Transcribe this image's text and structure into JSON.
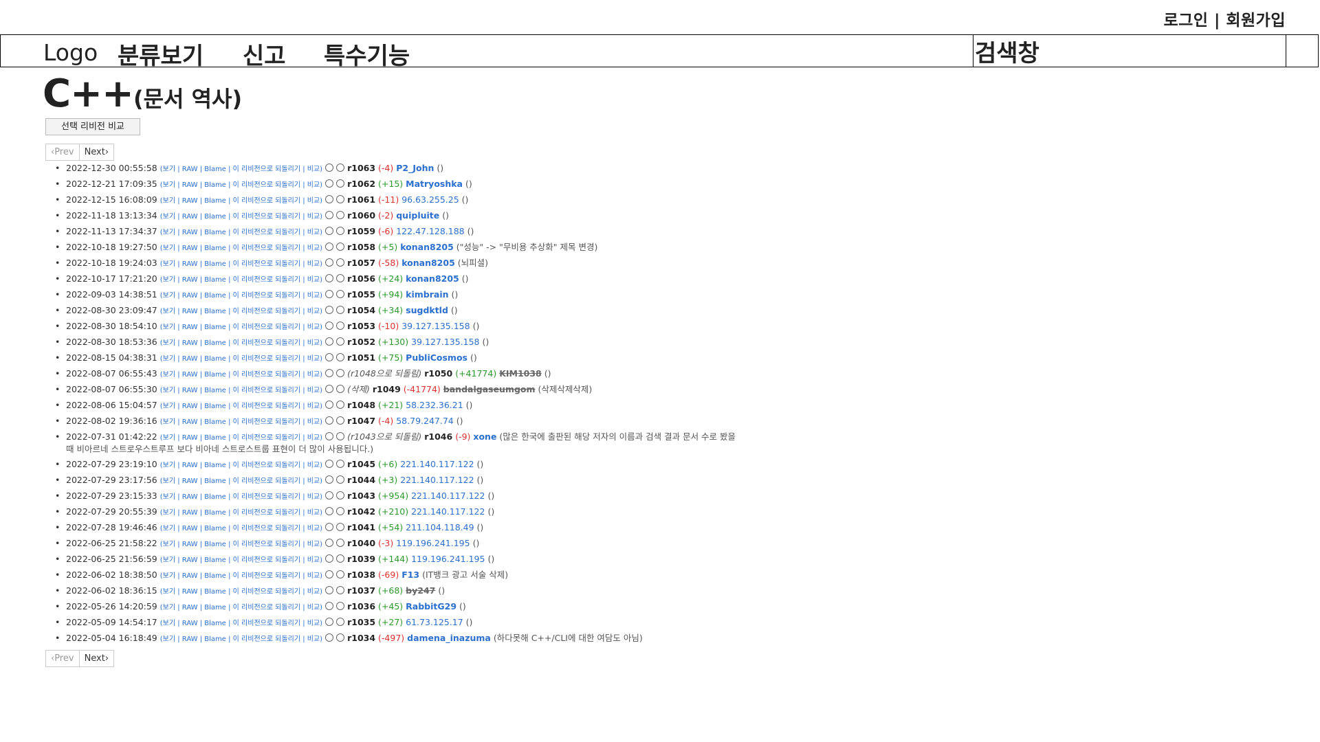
{
  "auth": {
    "login": "로그인",
    "sep": " | ",
    "signup": "회원가입"
  },
  "nav": {
    "logo": "Logo",
    "category": "분류보기",
    "report": "신고",
    "special": "특수기능",
    "search": "검색창"
  },
  "title": {
    "main": "C++",
    "sub": "(문서 역사)"
  },
  "compare_button": "선택 리비전 비교",
  "pager": {
    "prev": "‹Prev",
    "next": "Next›"
  },
  "link_labels": {
    "open": "(",
    "view": "보기",
    "raw": "RAW",
    "blame": "Blame",
    "revert": "이 리비전으로 되돌리기",
    "compare": "비교",
    "close": ")"
  },
  "revisions": [
    {
      "date": "2022-12-30 00:55:58",
      "rev": "r1063",
      "change": "(-4)",
      "sign": "neg",
      "author": "P2_John",
      "author_type": "user",
      "note": "()"
    },
    {
      "date": "2022-12-21 17:09:35",
      "rev": "r1062",
      "change": "(+15)",
      "sign": "pos",
      "author": "Matryoshka",
      "author_type": "user",
      "note": "()"
    },
    {
      "date": "2022-12-15 16:08:09",
      "rev": "r1061",
      "change": "(-11)",
      "sign": "neg",
      "author": "96.63.255.25",
      "author_type": "ip",
      "note": "()"
    },
    {
      "date": "2022-11-18 13:13:34",
      "rev": "r1060",
      "change": "(-2)",
      "sign": "neg",
      "author": "quipluite",
      "author_type": "user",
      "note": "()"
    },
    {
      "date": "2022-11-13 17:34:37",
      "rev": "r1059",
      "change": "(-6)",
      "sign": "neg",
      "author": "122.47.128.188",
      "author_type": "ip",
      "note": "()"
    },
    {
      "date": "2022-10-18 19:27:50",
      "rev": "r1058",
      "change": "(+5)",
      "sign": "pos",
      "author": "konan8205",
      "author_type": "user",
      "note": "(\"성능\" -> \"무비용 추상화\" 제목 변경)"
    },
    {
      "date": "2022-10-18 19:24:03",
      "rev": "r1057",
      "change": "(-58)",
      "sign": "neg",
      "author": "konan8205",
      "author_type": "user",
      "note": "(뇌피셜)"
    },
    {
      "date": "2022-10-17 17:21:20",
      "rev": "r1056",
      "change": "(+24)",
      "sign": "pos",
      "author": "konan8205",
      "author_type": "user",
      "note": "()"
    },
    {
      "date": "2022-09-03 14:38:51",
      "rev": "r1055",
      "change": "(+94)",
      "sign": "pos",
      "author": "kimbrain",
      "author_type": "user",
      "note": "()"
    },
    {
      "date": "2022-08-30 23:09:47",
      "rev": "r1054",
      "change": "(+34)",
      "sign": "pos",
      "author": "sugdktld",
      "author_type": "user",
      "note": "()"
    },
    {
      "date": "2022-08-30 18:54:10",
      "rev": "r1053",
      "change": "(-10)",
      "sign": "neg",
      "author": "39.127.135.158",
      "author_type": "ip",
      "note": "()"
    },
    {
      "date": "2022-08-30 18:53:36",
      "rev": "r1052",
      "change": "(+130)",
      "sign": "pos",
      "author": "39.127.135.158",
      "author_type": "ip",
      "note": "()"
    },
    {
      "date": "2022-08-15 04:38:31",
      "rev": "r1051",
      "change": "(+75)",
      "sign": "pos",
      "author": "PubliCosmos",
      "author_type": "user",
      "note": "()"
    },
    {
      "date": "2022-08-07 06:55:43",
      "tag": "(r1048으로 되돌림)",
      "rev": "r1050",
      "change": "(+41774)",
      "sign": "pos",
      "author": "KIM1038",
      "author_type": "deleted",
      "note": "()"
    },
    {
      "date": "2022-08-07 06:55:30",
      "tag": "(삭제)",
      "rev": "r1049",
      "change": "(-41774)",
      "sign": "neg",
      "author": "bandalgaseumgom",
      "author_type": "deleted",
      "note": "(삭제삭제삭제)"
    },
    {
      "date": "2022-08-06 15:04:57",
      "rev": "r1048",
      "change": "(+21)",
      "sign": "pos",
      "author": "58.232.36.21",
      "author_type": "ip",
      "note": "()"
    },
    {
      "date": "2022-08-02 19:36:16",
      "rev": "r1047",
      "change": "(-4)",
      "sign": "neg",
      "author": "58.79.247.74",
      "author_type": "ip",
      "note": "()"
    },
    {
      "date": "2022-07-31 01:42:22",
      "tag": "(r1043으로 되돌림)",
      "rev": "r1046",
      "change": "(-9)",
      "sign": "neg",
      "author": "xone",
      "author_type": "user",
      "note": "(많은 한국에 출판된 해당 저자의 이름과 검색 결과 문서 수로 봤을 때 비아르네 스트로우스트루프 보다 비아네 스트로스트룹 표현이 더 많이 사용됩니다.)",
      "tall": true
    },
    {
      "date": "2022-07-29 23:19:10",
      "rev": "r1045",
      "change": "(+6)",
      "sign": "pos",
      "author": "221.140.117.122",
      "author_type": "ip",
      "note": "()"
    },
    {
      "date": "2022-07-29 23:17:56",
      "rev": "r1044",
      "change": "(+3)",
      "sign": "pos",
      "author": "221.140.117.122",
      "author_type": "ip",
      "note": "()"
    },
    {
      "date": "2022-07-29 23:15:33",
      "rev": "r1043",
      "change": "(+954)",
      "sign": "pos",
      "author": "221.140.117.122",
      "author_type": "ip",
      "note": "()"
    },
    {
      "date": "2022-07-29 20:55:39",
      "rev": "r1042",
      "change": "(+210)",
      "sign": "pos",
      "author": "221.140.117.122",
      "author_type": "ip",
      "note": "()"
    },
    {
      "date": "2022-07-28 19:46:46",
      "rev": "r1041",
      "change": "(+54)",
      "sign": "pos",
      "author": "211.104.118.49",
      "author_type": "ip",
      "note": "()"
    },
    {
      "date": "2022-06-25 21:58:22",
      "rev": "r1040",
      "change": "(-3)",
      "sign": "neg",
      "author": "119.196.241.195",
      "author_type": "ip",
      "note": "()"
    },
    {
      "date": "2022-06-25 21:56:59",
      "rev": "r1039",
      "change": "(+144)",
      "sign": "pos",
      "author": "119.196.241.195",
      "author_type": "ip",
      "note": "()"
    },
    {
      "date": "2022-06-02 18:38:50",
      "rev": "r1038",
      "change": "(-69)",
      "sign": "neg",
      "author": "F13",
      "author_type": "user",
      "note": "(IT뱅크 광고 서술 삭제)"
    },
    {
      "date": "2022-06-02 18:36:15",
      "rev": "r1037",
      "change": "(+68)",
      "sign": "pos",
      "author": "by247",
      "author_type": "deleted",
      "note": "()"
    },
    {
      "date": "2022-05-26 14:20:59",
      "rev": "r1036",
      "change": "(+45)",
      "sign": "pos",
      "author": "RabbitG29",
      "author_type": "user",
      "note": "()"
    },
    {
      "date": "2022-05-09 14:54:17",
      "rev": "r1035",
      "change": "(+27)",
      "sign": "pos",
      "author": "61.73.125.17",
      "author_type": "ip",
      "note": "()"
    },
    {
      "date": "2022-05-04 16:18:49",
      "rev": "r1034",
      "change": "(-497)",
      "sign": "neg",
      "author": "damena_inazuma",
      "author_type": "user",
      "note": "(하다못해 C++/CLI에 대한 여담도 아님)"
    }
  ]
}
